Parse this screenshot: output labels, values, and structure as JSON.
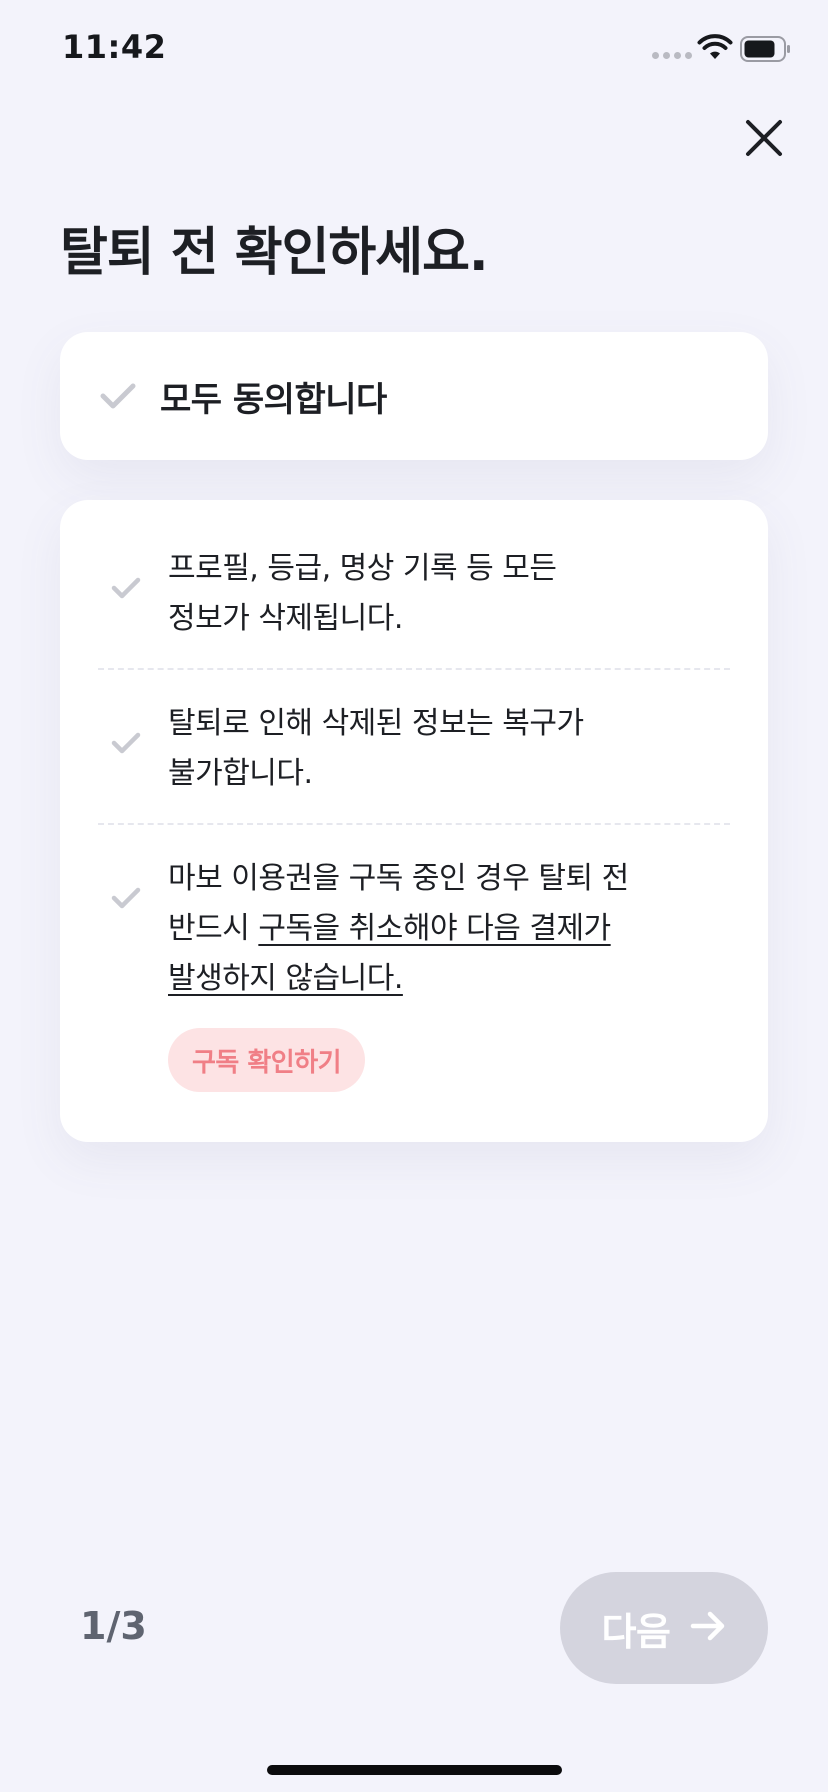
{
  "status_bar": {
    "time": "11:42"
  },
  "header": {
    "title": "탈퇴 전 확인하세요.",
    "close_icon": "close-icon"
  },
  "agree_all": {
    "label": "모두 동의합니다",
    "checked": false
  },
  "terms": [
    {
      "line1": "프로필, 등급, 명상 기록 등 모든",
      "line2": "정보가 삭제됩니다.",
      "checked": false
    },
    {
      "line1": "탈퇴로 인해 삭제된 정보는 복구가",
      "line2": "불가합니다.",
      "checked": false
    },
    {
      "line1": "마보 이용권을 구독 중인 경우 탈퇴 전",
      "line2_plain": "반드시 ",
      "line2_underlined": "구독을 취소해야 다음 결제가",
      "line3_underlined": "발생하지 않습니다.",
      "checked": false
    }
  ],
  "subscription_button": {
    "label": "구독 확인하기"
  },
  "footer": {
    "step": "1/3",
    "next_label": "다음"
  },
  "colors": {
    "background": "#f3f3fb",
    "card": "#ffffff",
    "check_inactive": "#c9cad1",
    "subscription_bg": "#fde3e4",
    "subscription_text": "#f07f86",
    "next_disabled": "#d4d4de"
  }
}
